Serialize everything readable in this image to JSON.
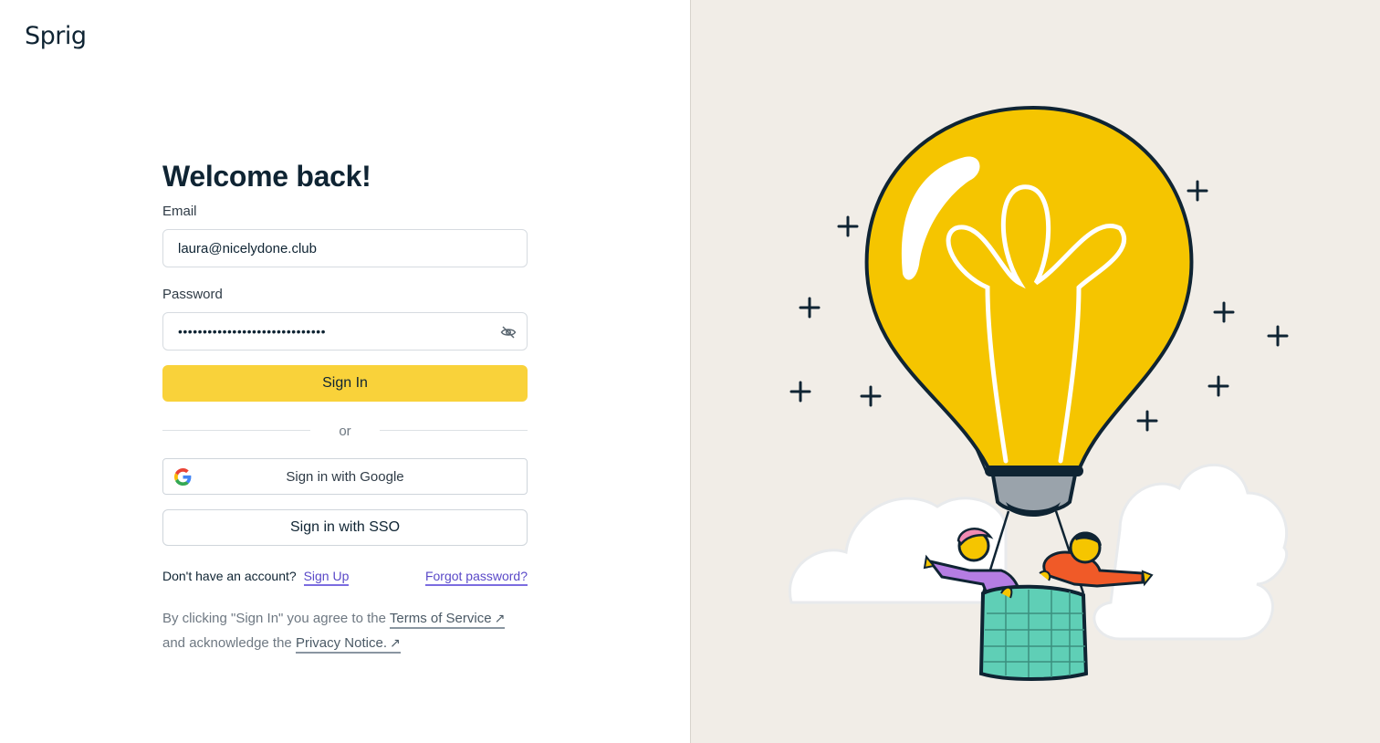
{
  "brand": {
    "logo_text": "Sprig"
  },
  "form": {
    "title": "Welcome back!",
    "email_label": "Email",
    "email_value": "laura@nicelydone.club",
    "password_label": "Password",
    "password_value": "••••••••••••••••••••••••••••••",
    "sign_in_label": "Sign In",
    "divider_text": "or",
    "google_label": "Sign in with Google",
    "sso_label": "Sign in with SSO"
  },
  "account": {
    "prompt": "Don't have an account?",
    "signup_label": "Sign Up",
    "forgot_label": "Forgot password?"
  },
  "legal": {
    "prefix": "By clicking \"Sign In\" you agree to the",
    "terms_label": "Terms of Service",
    "middle": "and acknowledge the",
    "privacy_label": "Privacy Notice.",
    "arrow": "↗"
  },
  "colors": {
    "accent": "#f9d23a",
    "link": "#5a49c8",
    "panel_bg": "#f1ede7",
    "balloon": "#f5c500"
  },
  "icons": [
    "eye-off-icon",
    "google-icon",
    "external-link-icon"
  ]
}
